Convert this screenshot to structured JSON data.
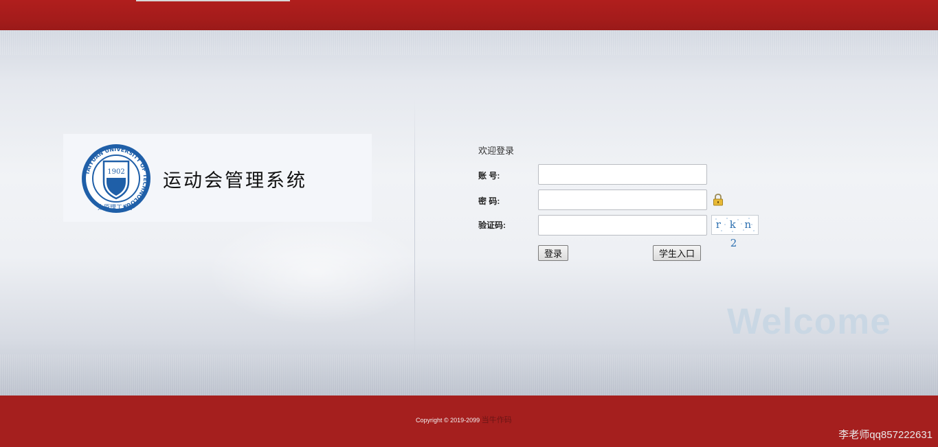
{
  "header": {},
  "logo": {
    "system_title": "运动会管理系统",
    "emblem_year": "1902",
    "emblem_ring_text": "TAIYUAN UNIVERSITY OF TECHNOLOGY",
    "emblem_calligraphy": "太原理工大学"
  },
  "login": {
    "heading": "欢迎登录",
    "account_label": "账 号:",
    "account_value": "",
    "password_label": "密 码:",
    "password_value": "",
    "captcha_label": "验证码:",
    "captcha_value": "",
    "captcha_text": "r k n 2",
    "login_button": "登录",
    "student_button": "学生入口"
  },
  "decor": {
    "welcome_word": "Welcome"
  },
  "footer": {
    "copyright": "Copyright © 2019-2099",
    "author": "当牛作码",
    "watermark": "李老师qq857222631"
  },
  "colors": {
    "brand_red": "#a51f1e",
    "emblem_blue": "#1f5fa8"
  }
}
